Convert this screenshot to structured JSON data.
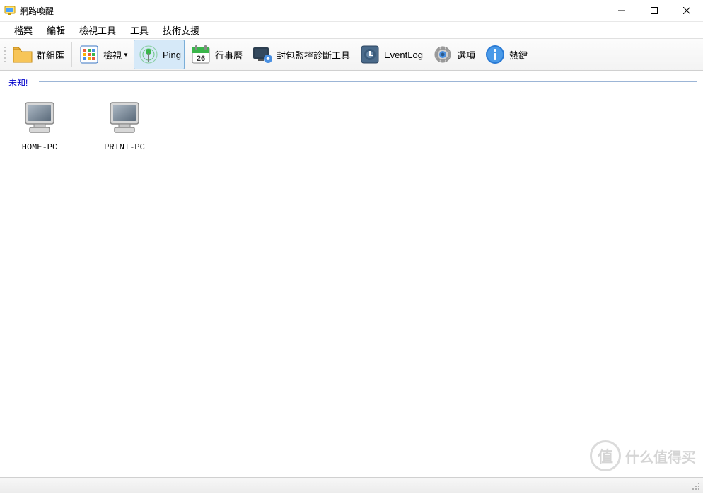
{
  "window": {
    "title": "網路喚醒"
  },
  "menu": {
    "file": "檔案",
    "edit": "編輯",
    "view_tools": "檢視工具",
    "tools": "工具",
    "support": "技術支援"
  },
  "toolbar": {
    "group": "群組匯",
    "view": "檢視",
    "ping": "Ping",
    "calendar": "行事曆",
    "packet": "封包監控診斷工具",
    "eventlog": "EventLog",
    "options": "選項",
    "hotkeys": "熱鍵",
    "calendar_day": "26"
  },
  "content": {
    "group_label": "未知!",
    "items": [
      {
        "name": "HOME-PC"
      },
      {
        "name": "PRINT-PC"
      }
    ]
  },
  "watermark": {
    "badge": "值",
    "text": "什么值得买"
  }
}
